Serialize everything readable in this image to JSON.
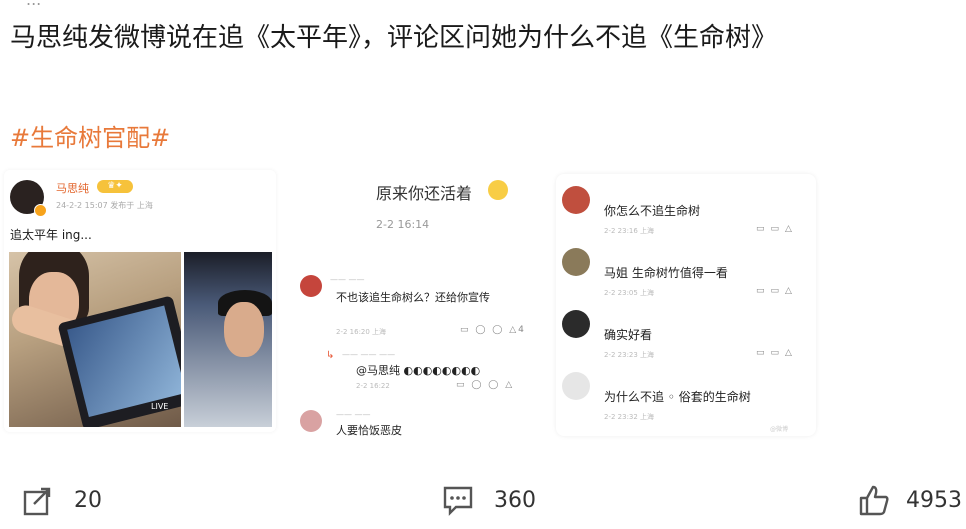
{
  "top_fragment": "...",
  "headline": "马思纯发微博说在追《太平年》，评论区问她为什么不追《生命树》",
  "hashtag": "#生命树官配#",
  "card1": {
    "user_name": "马思纯",
    "badge": "♛✦",
    "meta": "24-2-2 15:07  发布于 上海",
    "post_text": "追太平年 ing...",
    "live_label": "LIVE"
  },
  "card2": {
    "title": "原来你还活着",
    "time": "2-2 16:14",
    "comment1": {
      "user": "—— ——",
      "text": "不也该追生命树么？还给你宣传",
      "meta": "2-2 16:20  上海",
      "actions": "▭ ◯ ◯ △4"
    },
    "reply": {
      "user": "—— ——  ——",
      "text": "@马思纯 ◐◐◐◐◐◐◐◐",
      "meta": "2-2 16:22",
      "actions": "▭ ◯ ◯ △"
    },
    "comment2": {
      "user": "—— ——",
      "text": "人要恰饭恶皮"
    }
  },
  "card3": {
    "comments": [
      {
        "text": "你怎么不追生命树",
        "meta": "2-2 23:16  上海",
        "actions": "▭▭△",
        "color": "#c04f3e"
      },
      {
        "text": "马姐 生命树竹值得一看",
        "meta": "2-2 23:05  上海",
        "actions": "▭▭△",
        "color": "#8a7a5a"
      },
      {
        "text": "确实好看",
        "meta": "2-2 23:23  上海",
        "actions": "▭▭△",
        "color": "#2b2b2b"
      },
      {
        "text": "为什么不追 ◦ 俗套的生命树",
        "meta": "2-2 23:32  上海",
        "actions": "▭▭△",
        "color": "#dddddd"
      }
    ],
    "watermark": "@微博"
  },
  "footer": {
    "share_count": "20",
    "comment_count": "360",
    "like_count": "4953"
  }
}
